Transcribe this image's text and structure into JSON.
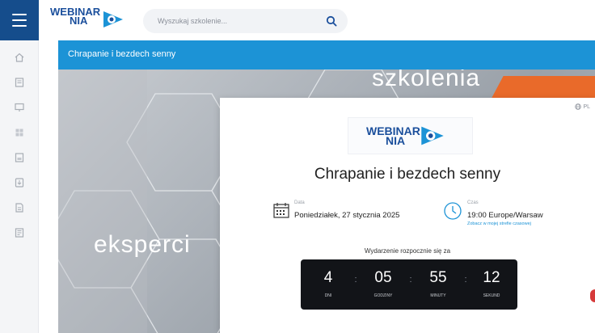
{
  "brand": {
    "line1": "WEBINAR",
    "line2": "NIA"
  },
  "search": {
    "placeholder": "Wyszukaj szkolenie..."
  },
  "icons": {
    "menu": "hamburger-menu-icon",
    "search": "search-icon",
    "sidebar": [
      "home-icon",
      "document-icon",
      "presentation-icon",
      "grid-icon",
      "list-icon",
      "download-icon",
      "file-icon",
      "report-icon"
    ],
    "language": "globe-icon",
    "date": "calendar-icon",
    "time": "clock-icon"
  },
  "header": {
    "title": "Chrapanie i bezdech senny"
  },
  "hero": {
    "word_top": "szkolenia",
    "word_left": "eksperci"
  },
  "card": {
    "language": "PL",
    "title": "Chrapanie i bezdech senny",
    "date": {
      "label": "Data",
      "value": "Poniedziałek, 27 stycznia 2025"
    },
    "time": {
      "label": "Czas",
      "value": "19:00 Europe/Warsaw",
      "link": "Zobacz w mojej strefie czasowej"
    },
    "countdown": {
      "label": "Wydarzenie rozpocznie się za",
      "days": {
        "value": "4",
        "label": "DNI"
      },
      "hours": {
        "value": "05",
        "label": "GODZINY"
      },
      "minutes": {
        "value": "55",
        "label": "MINUTY"
      },
      "seconds": {
        "value": "12",
        "label": "SEKUND"
      }
    }
  },
  "colors": {
    "sidebar_accent": "#154d8c",
    "header_blue": "#1c93d6",
    "brand_blue": "#1b4f9c",
    "countdown_bg": "#121418",
    "hero_orange": "#e96a2a"
  }
}
